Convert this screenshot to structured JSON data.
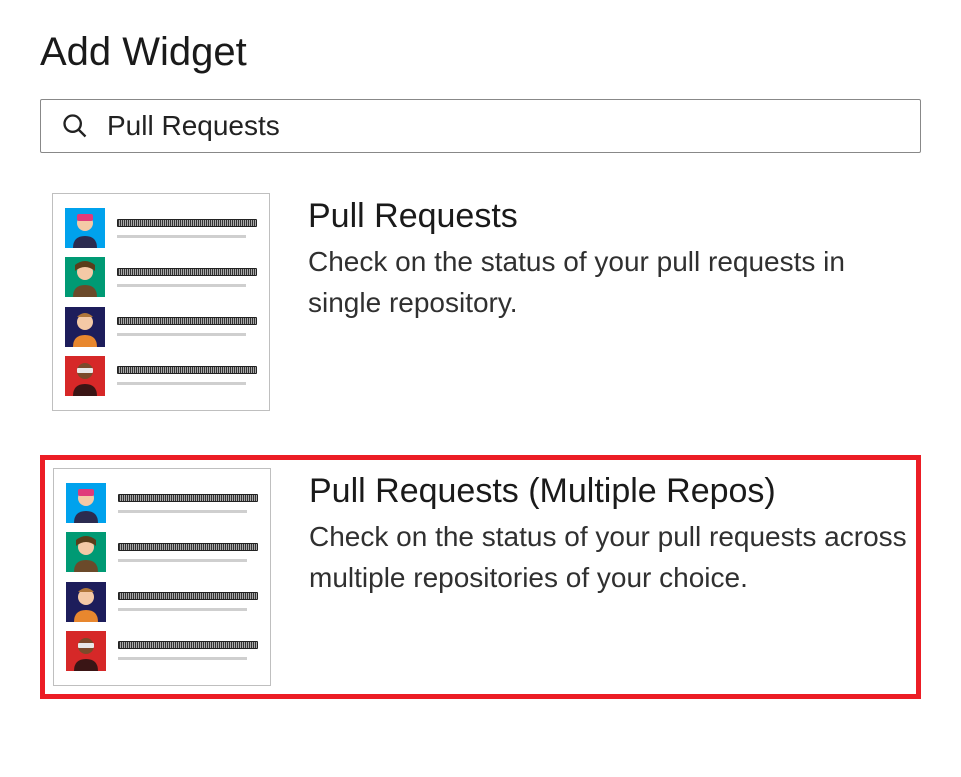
{
  "pageTitle": "Add Widget",
  "search": {
    "value": "Pull Requests"
  },
  "widgets": [
    {
      "title": "Pull Requests",
      "description": "Check on the status of your pull requests in single repository.",
      "selected": false
    },
    {
      "title": "Pull Requests (Multiple Repos)",
      "description": "Check on the status of your pull requests across multiple repositories of your choice.",
      "selected": true
    }
  ],
  "previewAvatarColors": [
    "#00a2ed",
    "#009a74",
    "#1d1d5b",
    "#d62828"
  ]
}
